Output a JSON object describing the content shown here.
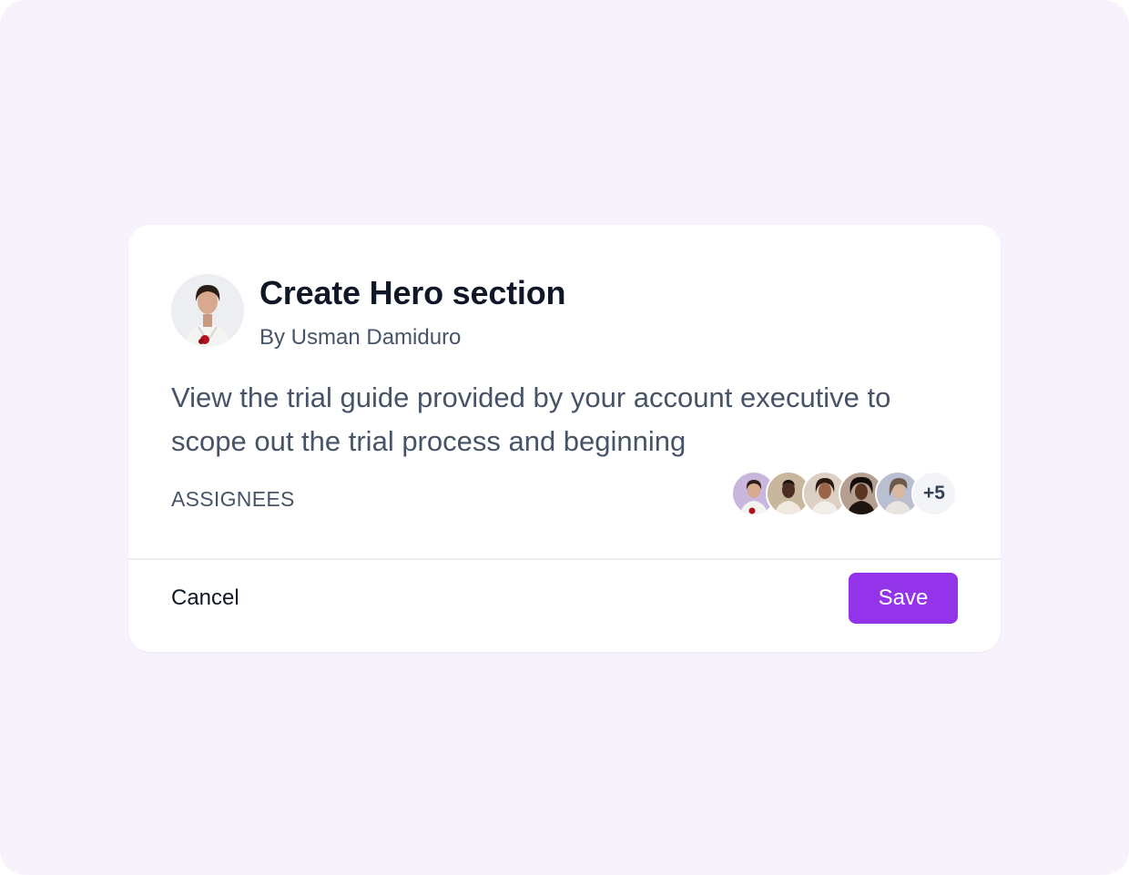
{
  "task": {
    "title": "Create Hero section",
    "byline": "By Usman Damiduro",
    "description": "View the trial guide provided by your account executive to scope out the trial process and beginning",
    "assignees_label": "ASSIGNEES",
    "assignees_more": "+5"
  },
  "author": {
    "avatar_icon": "woman-portrait-avatar"
  },
  "actions": {
    "cancel_label": "Cancel",
    "save_label": "Save"
  },
  "colors": {
    "page_background": "#f7f2fc",
    "card_background": "#ffffff",
    "primary_button": "#9333ea",
    "title_text": "#101828",
    "body_text": "#475467"
  }
}
